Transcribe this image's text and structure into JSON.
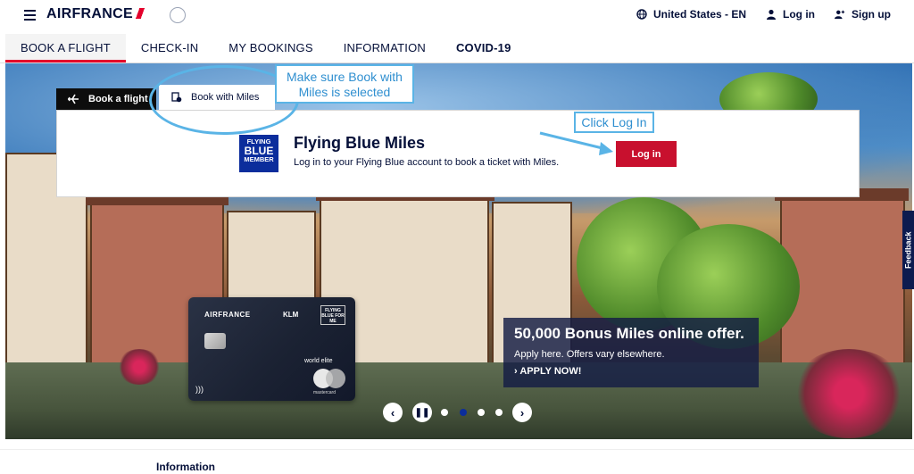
{
  "header": {
    "logo_text": "AIRFRANCE",
    "locale": "United States - EN",
    "login": "Log in",
    "signup": "Sign up",
    "icons": [
      "menu-icon",
      "globe-icon",
      "user-icon",
      "user-add-icon"
    ]
  },
  "tabs": [
    {
      "label": "BOOK A FLIGHT",
      "active": true
    },
    {
      "label": "CHECK-IN",
      "active": false
    },
    {
      "label": "MY BOOKINGS",
      "active": false
    },
    {
      "label": "INFORMATION",
      "active": false
    },
    {
      "label": "COVID-19",
      "active": false
    }
  ],
  "booking": {
    "tab_flight": "Book a flight",
    "tab_miles": "Book with Miles",
    "badge_line1": "FLYING",
    "badge_line2": "BLUE",
    "badge_line3": "MEMBER",
    "title": "Flying Blue Miles",
    "subtitle": "Log in to your Flying Blue account to book a ticket with Miles.",
    "login_button": "Log in"
  },
  "annotations": {
    "miles_note": "Make sure Book with Miles is selected",
    "login_note": "Click Log In"
  },
  "card": {
    "brand": "AIRFRANCE",
    "partner": "KLM",
    "badge": "FLYING BLUE FOR ME",
    "tier": "world elite",
    "network": "mastercard"
  },
  "promo": {
    "headline": "50,000 Bonus Miles online offer.",
    "subtext": "Apply here. Offers vary elsewhere.",
    "cta": "APPLY NOW!"
  },
  "carousel": {
    "slides": 4,
    "active_index": 1
  },
  "feedback_tab": "Feedback",
  "footer": {
    "section_heading": "Information"
  },
  "colors": {
    "brand_navy": "#051039",
    "brand_red": "#e4002b",
    "button_red": "#c8102e",
    "annotation_blue": "#5ab4e6",
    "flying_blue": "#0b2d9c"
  }
}
